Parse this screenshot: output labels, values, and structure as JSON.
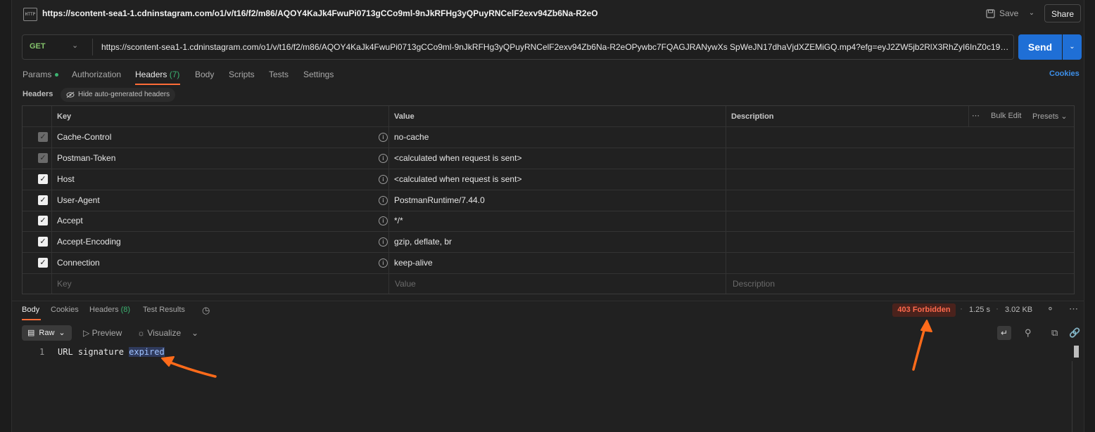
{
  "request": {
    "title": "https://scontent-sea1-1.cdninstagram.com/o1/v/t16/f2/m86/AQOY4KaJk4FwuPi0713gCCo9ml-9nJkRFHg3yQPuyRNCelF2exv94Zb6Na-R2eO",
    "icon_label": "HTTP",
    "save_label": "Save",
    "share_label": "Share",
    "method": "GET",
    "url": "https://scontent-sea1-1.cdninstagram.com/o1/v/t16/f2/m86/AQOY4KaJk4FwuPi0713gCCo9ml-9nJkRFHg3yQPuyRNCelF2exv94Zb6Na-R2eOPywbc7FQAGJRANywXs SpWeJN17dhaVjdXZEMiGQ.mp4?efg=eyJ2ZW5jb2RlX3RhZyI6InZ0c192b2RfdXJsZ2Vu...",
    "send_label": "Send"
  },
  "tabs": {
    "params": "Params",
    "authorization": "Authorization",
    "headers": "Headers",
    "headers_count": "(7)",
    "body": "Body",
    "scripts": "Scripts",
    "tests": "Tests",
    "settings": "Settings",
    "cookies": "Cookies"
  },
  "headers_section": {
    "label": "Headers",
    "hide_auto": "Hide auto-generated headers"
  },
  "table": {
    "columns": {
      "key": "Key",
      "value": "Value",
      "description": "Description"
    },
    "bulk_edit": "Bulk Edit",
    "presets": "Presets",
    "rows": [
      {
        "key": "Cache-Control",
        "value": "no-cache",
        "checked": "dim"
      },
      {
        "key": "Postman-Token",
        "value": "<calculated when request is sent>",
        "checked": "dim"
      },
      {
        "key": "Host",
        "value": "<calculated when request is sent>",
        "checked": "on"
      },
      {
        "key": "User-Agent",
        "value": "PostmanRuntime/7.44.0",
        "checked": "on"
      },
      {
        "key": "Accept",
        "value": "*/*",
        "checked": "on"
      },
      {
        "key": "Accept-Encoding",
        "value": "gzip, deflate, br",
        "checked": "on"
      },
      {
        "key": "Connection",
        "value": "keep-alive",
        "checked": "on"
      }
    ],
    "placeholder": {
      "key": "Key",
      "value": "Value",
      "description": "Description"
    }
  },
  "response": {
    "tabs": {
      "body": "Body",
      "cookies": "Cookies",
      "headers": "Headers",
      "headers_count": "(8)",
      "test_results": "Test Results"
    },
    "status": "403 Forbidden",
    "time": "1.25 s",
    "size": "3.02 KB",
    "format": "Raw",
    "preview": "Preview",
    "visualize": "Visualize",
    "line_number": "1",
    "body_text": "URL signature ",
    "body_highlight": "expired"
  },
  "colors": {
    "accent": "#ff6c37",
    "send": "#1f6fd6",
    "status_error": "#ff6a4d",
    "method_get": "#85c46c",
    "arrow": "#ff6b1a"
  }
}
